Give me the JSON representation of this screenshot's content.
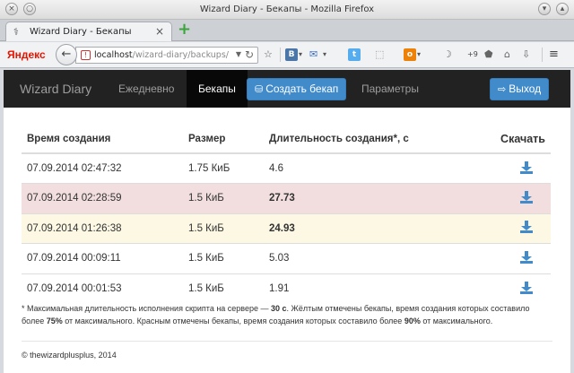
{
  "window": {
    "title": "Wizard Diary - Бекапы - Mozilla Firefox"
  },
  "tab": {
    "title": "Wizard Diary - Бекапы",
    "close": "×",
    "new": "+"
  },
  "toolbar": {
    "search_engine": "Яндекс",
    "url_host": "localhost",
    "url_path": "/wizard-diary/backups/",
    "addon_counter": "+9"
  },
  "app": {
    "brand": "Wizard Diary",
    "nav": {
      "daily": "Ежедневно",
      "backups": "Бекапы",
      "create": "Создать бекап",
      "settings": "Параметры",
      "logout": "Выход"
    },
    "table": {
      "headers": [
        "Время создания",
        "Размер",
        "Длительность создания*, с",
        "Скачать"
      ],
      "rows": [
        {
          "time": "07.09.2014 02:47:32",
          "size": "1.75 КиБ",
          "duration": "4.6",
          "status": "normal"
        },
        {
          "time": "07.09.2014 02:28:59",
          "size": "1.5 КиБ",
          "duration": "27.73",
          "status": "danger"
        },
        {
          "time": "07.09.2014 01:26:38",
          "size": "1.5 КиБ",
          "duration": "24.93",
          "status": "warning"
        },
        {
          "time": "07.09.2014 00:09:11",
          "size": "1.5 КиБ",
          "duration": "5.03",
          "status": "normal"
        },
        {
          "time": "07.09.2014 00:01:53",
          "size": "1.5 КиБ",
          "duration": "1.91",
          "status": "normal"
        }
      ]
    },
    "note": {
      "p1": "* Максимальная длительность исполнения скрипта на сервере — ",
      "b1": "30 с",
      "p2": ". Жёлтым отмечены бекапы, время создания которых составило более ",
      "b2": "75%",
      "p3": " от максимального. Красным отмечены бекапы, время создания которых составило более ",
      "b3": "90%",
      "p4": " от максимального."
    },
    "footer": "© thewizardplusplus, 2014"
  },
  "colors": {
    "primary": "#428bca",
    "danger_row": "#f2dede",
    "warning_row": "#fcf8e3",
    "navbar": "#222222"
  }
}
